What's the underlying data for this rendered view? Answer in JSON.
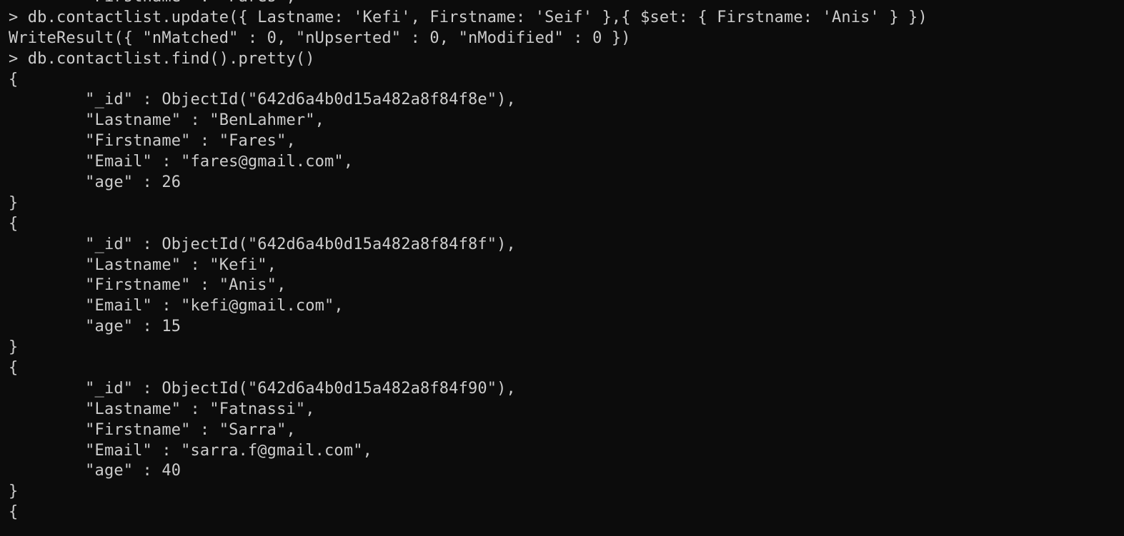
{
  "terminal": {
    "lines": [
      "        \"Firstname\" : \"Fares\",",
      "> db.contactlist.update({ Lastname: 'Kefi', Firstname: 'Seif' },{ $set: { Firstname: 'Anis' } })",
      "WriteResult({ \"nMatched\" : 0, \"nUpserted\" : 0, \"nModified\" : 0 })",
      "> db.contactlist.find().pretty()",
      "{",
      "        \"_id\" : ObjectId(\"642d6a4b0d15a482a8f84f8e\"),",
      "        \"Lastname\" : \"BenLahmer\",",
      "        \"Firstname\" : \"Fares\",",
      "        \"Email\" : \"fares@gmail.com\",",
      "        \"age\" : 26",
      "}",
      "{",
      "        \"_id\" : ObjectId(\"642d6a4b0d15a482a8f84f8f\"),",
      "        \"Lastname\" : \"Kefi\",",
      "        \"Firstname\" : \"Anis\",",
      "        \"Email\" : \"kefi@gmail.com\",",
      "        \"age\" : 15",
      "}",
      "{",
      "        \"_id\" : ObjectId(\"642d6a4b0d15a482a8f84f90\"),",
      "        \"Lastname\" : \"Fatnassi\",",
      "        \"Firstname\" : \"Sarra\",",
      "        \"Email\" : \"sarra.f@gmail.com\",",
      "        \"age\" : 40",
      "}",
      "{"
    ]
  },
  "colors": {
    "background": "#0c0c0c",
    "foreground": "#cccccc"
  }
}
